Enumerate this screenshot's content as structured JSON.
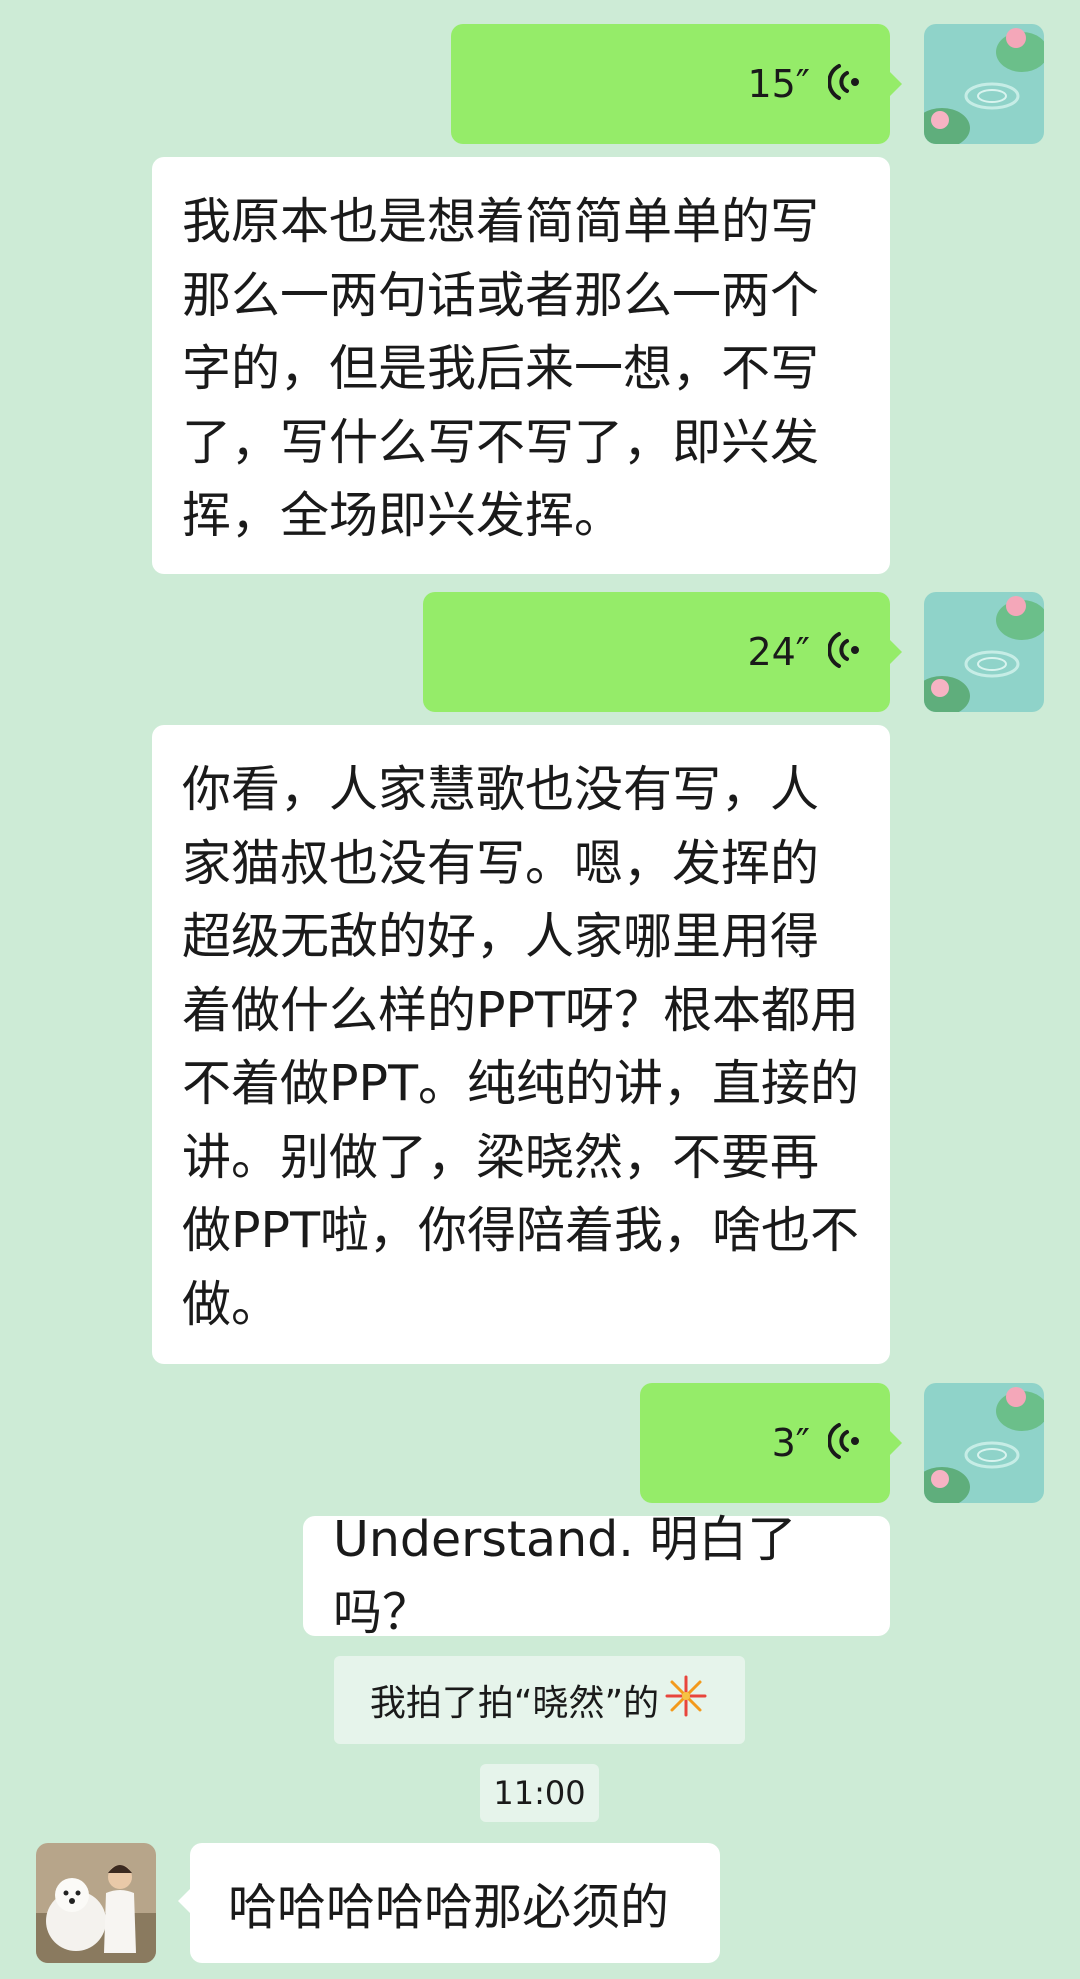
{
  "messages": [
    {
      "type": "voice",
      "from": "self",
      "duration": "15″"
    },
    {
      "type": "transcript",
      "text": "我原本也是想着简简单单的写那么一两句话或者那么一两个字的，但是我后来一想，不写了，写什么写不写了，即兴发挥，全场即兴发挥。"
    },
    {
      "type": "voice",
      "from": "self",
      "duration": "24″"
    },
    {
      "type": "transcript",
      "text": "你看，人家慧歌也没有写，人家猫叔也没有写。嗯，发挥的超级无敌的好，人家哪里用得着做什么样的PPT呀？根本都用不着做PPT。纯纯的讲，直接的讲。别做了，梁晓然，不要再做PPT啦，你得陪着我，啥也不做。"
    },
    {
      "type": "voice",
      "from": "self",
      "duration": "3″"
    },
    {
      "type": "transcript",
      "text": "Understand. 明白了吗？"
    },
    {
      "type": "system",
      "text": "我拍了拍“晓然”的"
    },
    {
      "type": "time",
      "text": "11:00"
    },
    {
      "type": "text",
      "from": "other",
      "text": "哈哈哈哈哈那必须的"
    }
  ],
  "colors": {
    "background": "#cdebd6",
    "sent_bubble": "#95ec69",
    "received_bubble": "#ffffff"
  }
}
